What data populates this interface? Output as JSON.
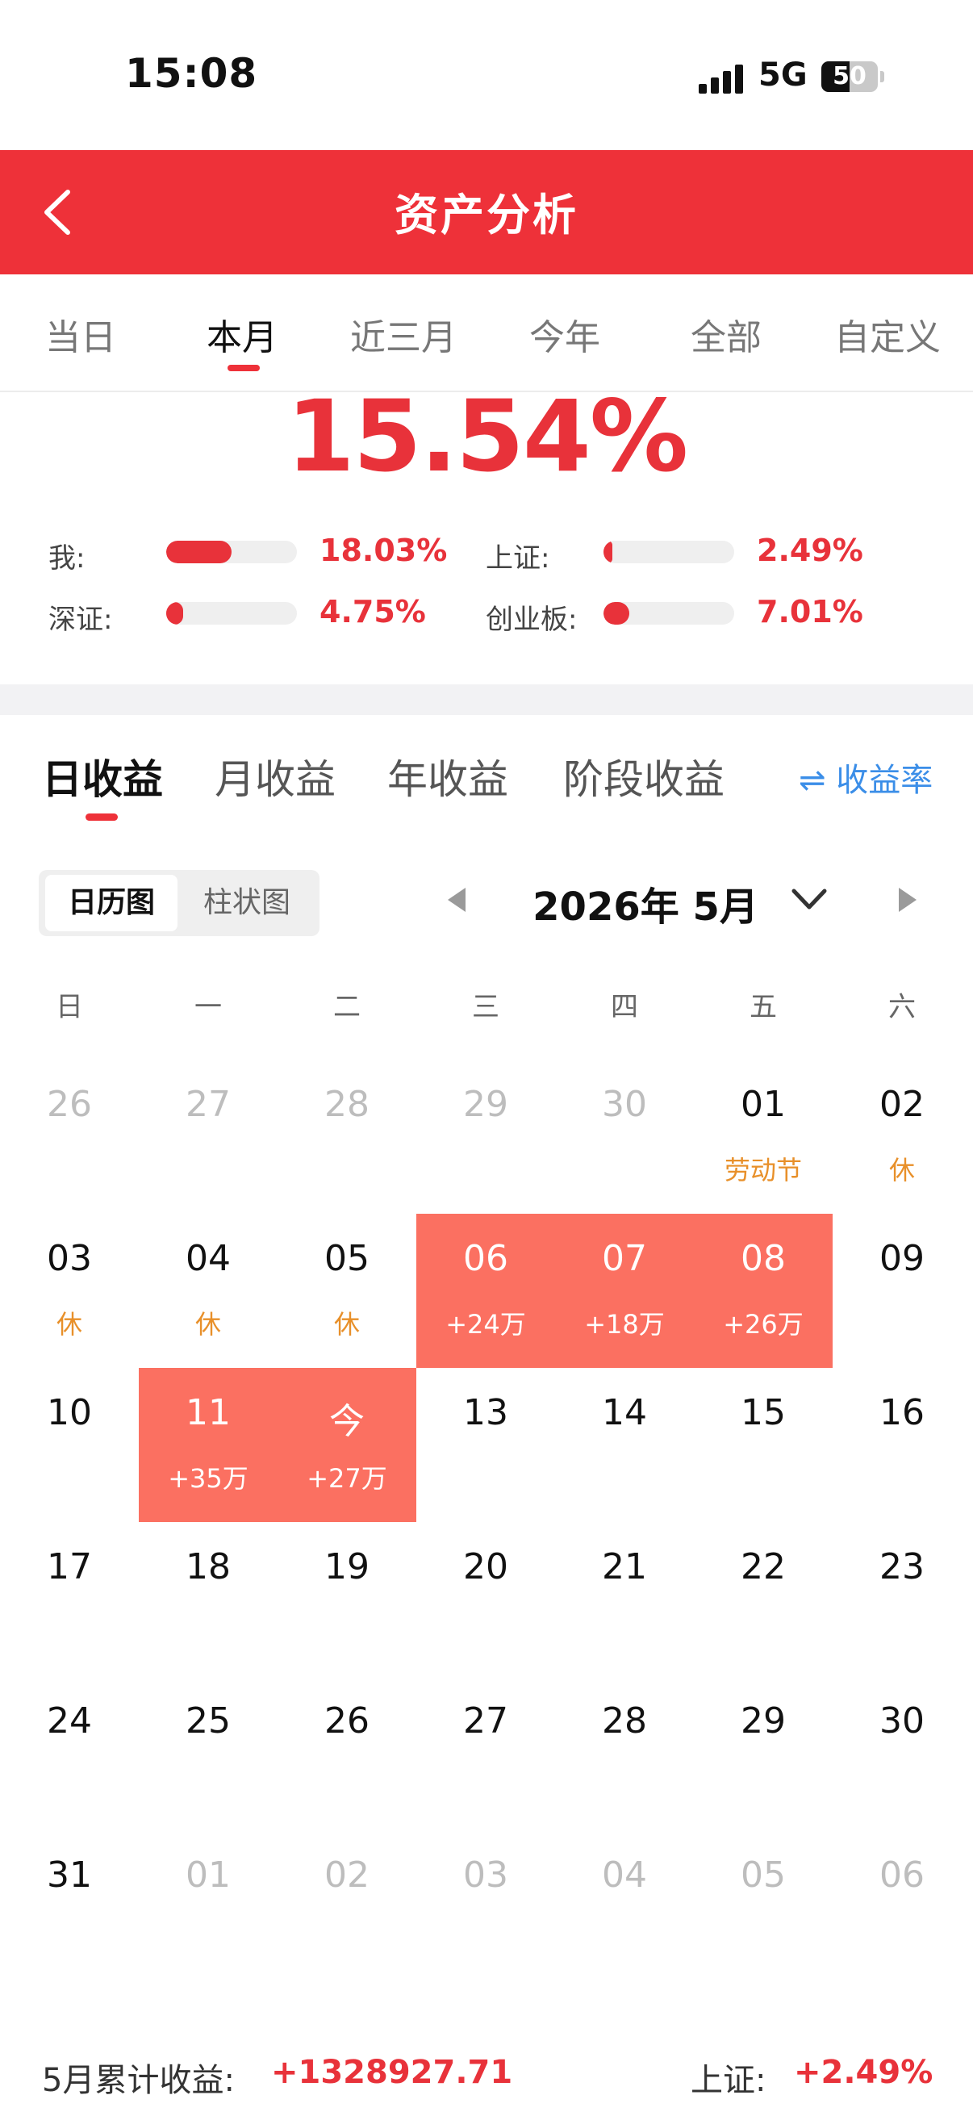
{
  "status_bar": {
    "time": "15:08",
    "network": "5G",
    "battery": "50",
    "battery_level": 0.5
  },
  "header": {
    "title": "资产分析"
  },
  "period_tabs": [
    "当日",
    "本月",
    "近三月",
    "今年",
    "全部",
    "自定义"
  ],
  "active_period": "本月",
  "summary": {
    "value": "15.54%",
    "benchmarks": [
      {
        "label": "我:",
        "value": "18.03%",
        "level": 0.5
      },
      {
        "label": "上证:",
        "value": "2.49%",
        "level": 0.07
      },
      {
        "label": "深证:",
        "value": "4.75%",
        "level": 0.13
      },
      {
        "label": "创业板:",
        "value": "7.01%",
        "level": 0.2
      }
    ]
  },
  "earnings_tabs": [
    "日收益",
    "月收益",
    "年收益",
    "阶段收益"
  ],
  "active_earnings_tab": "日收益",
  "rate_link": "⇌ 收益率",
  "view_toggle": [
    "日历图",
    "柱状图"
  ],
  "active_view": "日历图",
  "month_label": "2026年 5月",
  "weekdays": [
    "日",
    "一",
    "二",
    "三",
    "四",
    "五",
    "六"
  ],
  "calendar": [
    [
      {
        "d": "26",
        "o": true
      },
      {
        "d": "27",
        "o": true
      },
      {
        "d": "28",
        "o": true
      },
      {
        "d": "29",
        "o": true
      },
      {
        "d": "30",
        "o": true
      },
      {
        "d": "01",
        "s": "劳动节"
      },
      {
        "d": "02",
        "s": "休"
      }
    ],
    [
      {
        "d": "03",
        "s": "休"
      },
      {
        "d": "04",
        "s": "休"
      },
      {
        "d": "05",
        "s": "休"
      },
      {
        "d": "06",
        "s": "+24万",
        "g": true
      },
      {
        "d": "07",
        "s": "+18万",
        "g": true
      },
      {
        "d": "08",
        "s": "+26万",
        "g": true
      },
      {
        "d": "09"
      }
    ],
    [
      {
        "d": "10"
      },
      {
        "d": "11",
        "s": "+35万",
        "g": true
      },
      {
        "d": "今",
        "s": "+27万",
        "g": true
      },
      {
        "d": "13"
      },
      {
        "d": "14"
      },
      {
        "d": "15"
      },
      {
        "d": "16"
      }
    ],
    [
      {
        "d": "17"
      },
      {
        "d": "18"
      },
      {
        "d": "19"
      },
      {
        "d": "20"
      },
      {
        "d": "21"
      },
      {
        "d": "22"
      },
      {
        "d": "23"
      }
    ],
    [
      {
        "d": "24"
      },
      {
        "d": "25"
      },
      {
        "d": "26"
      },
      {
        "d": "27"
      },
      {
        "d": "28"
      },
      {
        "d": "29"
      },
      {
        "d": "30"
      }
    ],
    [
      {
        "d": "31"
      },
      {
        "d": "01",
        "o": true
      },
      {
        "d": "02",
        "o": true
      },
      {
        "d": "03",
        "o": true
      },
      {
        "d": "04",
        "o": true
      },
      {
        "d": "05",
        "o": true
      },
      {
        "d": "06",
        "o": true
      }
    ]
  ],
  "footer": {
    "label": "5月累计收益:",
    "value": "+1328927.71",
    "index_label": "上证:",
    "index_value": "+2.49%"
  },
  "colors": {
    "brand_red": "#ee3139",
    "value_red": "#e8323a",
    "gain_cell": "#fb7061",
    "holiday": "#e8902a",
    "link_blue": "#3b8ee8"
  }
}
